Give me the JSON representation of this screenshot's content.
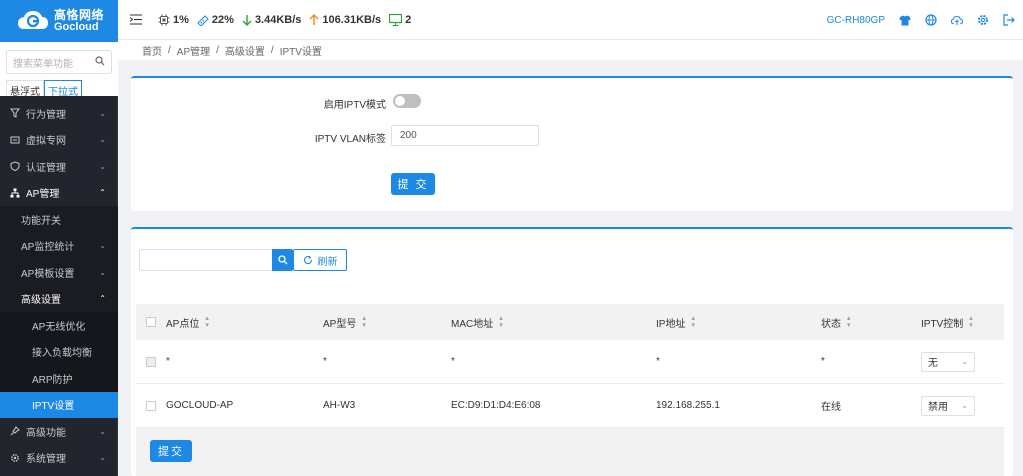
{
  "brand": {
    "cn": "高恪网络",
    "en": "Gocloud"
  },
  "sidebar": {
    "search_placeholder": "搜索菜单功能",
    "mode_options": [
      "悬浮式",
      "下拉式"
    ],
    "items": [
      {
        "label": "行为管理",
        "icon": "filter-icon"
      },
      {
        "label": "虚拟专网",
        "icon": "vpn-icon"
      },
      {
        "label": "认证管理",
        "icon": "shield-icon"
      },
      {
        "label": "AP管理",
        "icon": "sitemap-icon"
      }
    ],
    "ap_sub": [
      {
        "label": "功能开关"
      },
      {
        "label": "AP监控统计"
      },
      {
        "label": "AP模板设置"
      },
      {
        "label": "高级设置"
      }
    ],
    "adv_sub": [
      {
        "label": "AP无线优化"
      },
      {
        "label": "接入负载均衡"
      },
      {
        "label": "ARP防护"
      },
      {
        "label": "IPTV设置"
      }
    ],
    "bottom": [
      {
        "label": "高级功能",
        "icon": "pin-icon"
      },
      {
        "label": "系统管理",
        "icon": "gear-icon"
      }
    ]
  },
  "topbar": {
    "cpu": "1%",
    "mem": "22%",
    "down": "3.44KB/s",
    "up": "106.31KB/s",
    "devices": "2",
    "model": "GC-RH80GP"
  },
  "breadcrumb": [
    "首页",
    "AP管理",
    "高级设置",
    "IPTV设置"
  ],
  "iptv_form": {
    "enable_label": "启用IPTV模式",
    "enable_on": false,
    "vlan_label": "IPTV VLAN标签",
    "vlan_value": "200",
    "submit": "提 交"
  },
  "list": {
    "refresh": "刷新",
    "columns": [
      "AP点位",
      "AP型号",
      "MAC地址",
      "IP地址",
      "状态",
      "IPTV控制"
    ],
    "rows": [
      {
        "point": "*",
        "model": "*",
        "mac": "*",
        "ip": "*",
        "status": "*",
        "iptv": "无"
      },
      {
        "point": "GOCLOUD-AP",
        "model": "AH-W3",
        "mac": "EC:D9:D1:D4:E6:08",
        "ip": "192.168.255.1",
        "status": "在线",
        "iptv": "禁用"
      }
    ],
    "submit": "提交"
  },
  "colors": {
    "accent": "#1e88e5",
    "sidebar": "#22252d"
  }
}
